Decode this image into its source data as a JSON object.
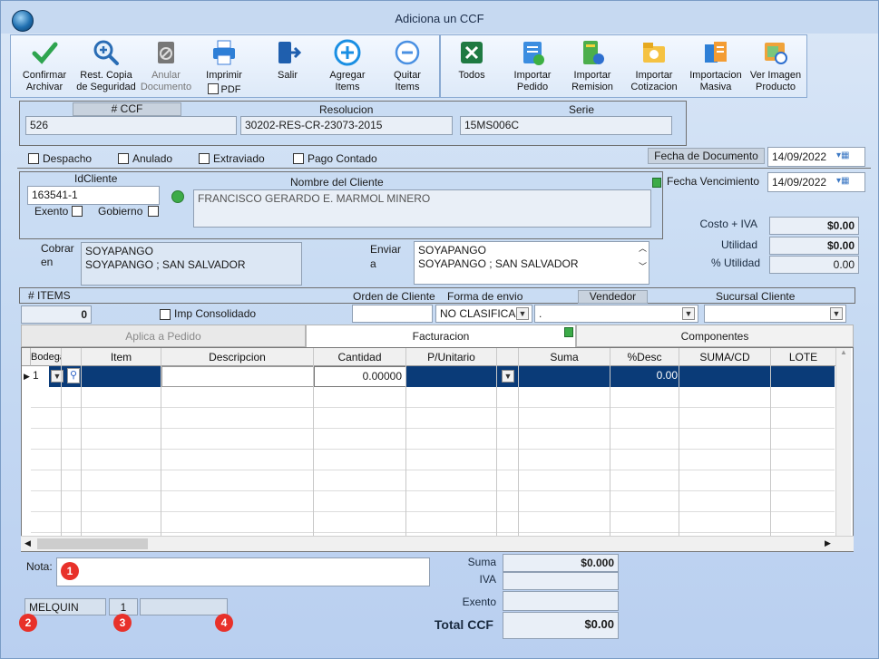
{
  "window": {
    "title": "Adiciona un CCF"
  },
  "toolbar": {
    "buttons": [
      {
        "label1": "Confirmar",
        "label2": "Archivar"
      },
      {
        "label1": "Rest. Copia",
        "label2": "de Seguridad"
      },
      {
        "label1": "Anular",
        "label2": "Documento"
      },
      {
        "label1": "Imprimir",
        "label2": "PDF"
      },
      {
        "label1": "Salir",
        "label2": ""
      },
      {
        "label1": "Agregar",
        "label2": "Items"
      },
      {
        "label1": "Quitar",
        "label2": "Items"
      }
    ],
    "buttons2": [
      {
        "label1": "Todos",
        "label2": ""
      },
      {
        "label1": "Importar",
        "label2": "Pedido"
      },
      {
        "label1": "Importar",
        "label2": "Remision"
      },
      {
        "label1": "Importar",
        "label2": "Cotizacion"
      },
      {
        "label1": "Importacion",
        "label2": "Masiva"
      },
      {
        "label1": "Ver Imagen",
        "label2": "Producto"
      }
    ]
  },
  "doc": {
    "ccf_label": "# CCF",
    "ccf_value": "526",
    "resolucion_label": "Resolucion",
    "resolucion_value": "30202-RES-CR-23073-2015",
    "serie_label": "Serie",
    "serie_value": "15MS006C"
  },
  "flags": {
    "despacho": "Despacho",
    "anulado": "Anulado",
    "extraviado": "Extraviado",
    "pago_contado": "Pago Contado"
  },
  "fechas": {
    "doc_label": "Fecha de Documento",
    "doc_value": "14/09/2022",
    "venc_label": "Fecha Vencimiento",
    "venc_value": "14/09/2022"
  },
  "cliente": {
    "id_label": "IdCliente",
    "id_value": "163541-1",
    "exento": "Exento",
    "gobierno": "Gobierno",
    "nombre_label": "Nombre del Cliente",
    "nombre_value": "FRANCISCO GERARDO E. MARMOL MINERO"
  },
  "costos": {
    "costo_label": "Costo + IVA",
    "costo_value": "$0.00",
    "utilidad_label": "Utilidad",
    "utilidad_value": "$0.00",
    "pct_label": "% Utilidad",
    "pct_value": "0.00"
  },
  "direcciones": {
    "cobrar_label1": "Cobrar",
    "cobrar_label2": "en",
    "cobrar_line1": "SOYAPANGO",
    "cobrar_line2": "SOYAPANGO ; SAN SALVADOR",
    "enviar_label1": "Enviar",
    "enviar_label2": "a",
    "enviar_line1": "SOYAPANGO",
    "enviar_line2": "SOYAPANGO ; SAN SALVADOR"
  },
  "items_bar": {
    "items_label": "# ITEMS",
    "items_value": "0",
    "imp_consolidado": "Imp Consolidado",
    "orden_label": "Orden de Cliente",
    "forma_label": "Forma de envio",
    "forma_value": "NO CLASIFICAD",
    "vendedor_label": "Vendedor",
    "vendedor_value": ".",
    "sucursal_label": "Sucursal Cliente"
  },
  "tabs": [
    "Aplica a Pedido",
    "Facturacion",
    "Componentes"
  ],
  "grid": {
    "headers": [
      "Bodega",
      "Item",
      "Descripcion",
      "Cantidad",
      "P/Unitario",
      "Suma",
      "%Desc",
      "SUMA/CD",
      "LOTE"
    ],
    "row": {
      "bodega": "1",
      "cantidad": "0.00000",
      "desc": "0.00"
    }
  },
  "footer": {
    "nota_label": "Nota:",
    "user": "MELQUIN",
    "num": "1",
    "badges": [
      "1",
      "2",
      "3",
      "4"
    ],
    "suma_label": "Suma",
    "suma_value": "$0.000",
    "iva_label": "IVA",
    "exento_label": "Exento",
    "total_label": "Total CCF",
    "total_value": "$0.00"
  }
}
